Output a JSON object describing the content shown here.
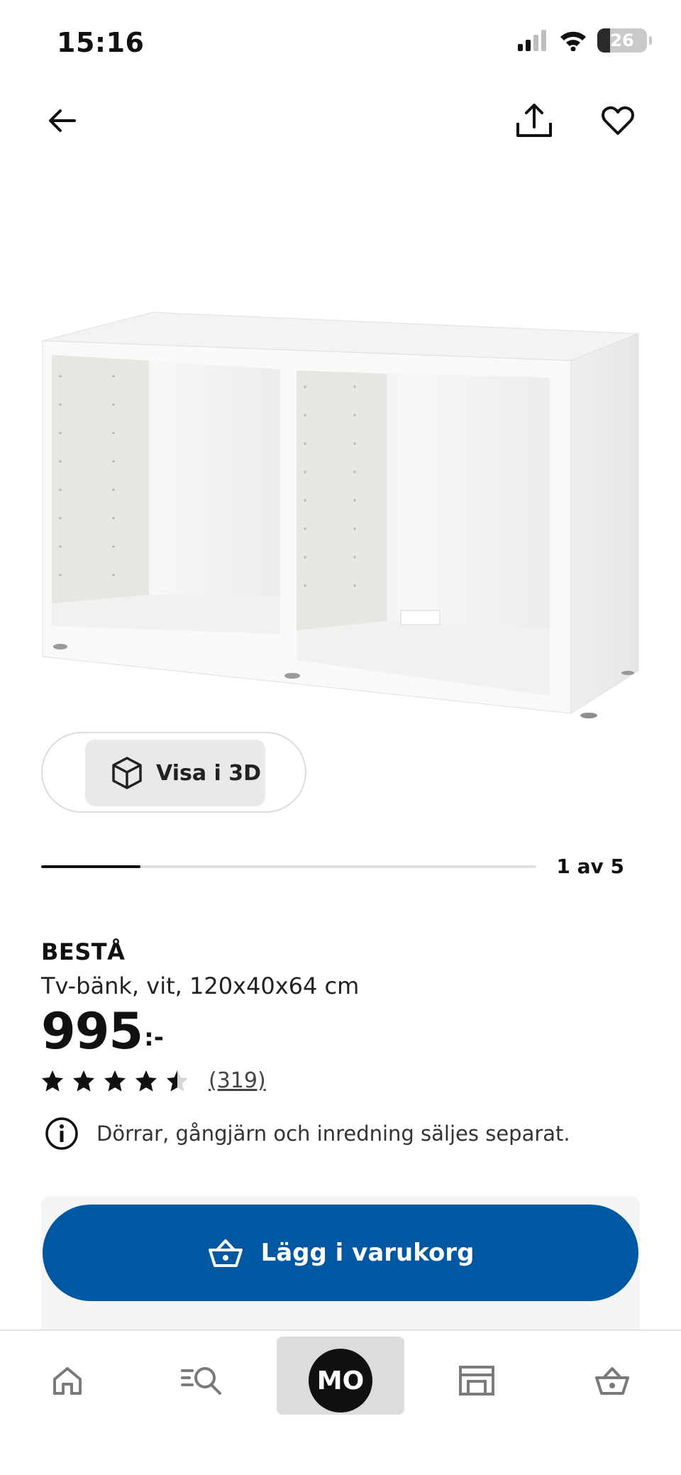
{
  "status_bar": {
    "time": "15:16",
    "battery": "26",
    "battery_level": 0.26
  },
  "topbar": {
    "back_icon": "arrow-left-icon",
    "share_icon": "share-icon",
    "favorite_icon": "heart-icon"
  },
  "gallery": {
    "view_3d_label": "Visa i 3D",
    "cube_icon": "cube-icon",
    "page_counter": "1 av 5",
    "current": 1,
    "total": 5
  },
  "product": {
    "brand": "BESTÅ",
    "description": "Tv-bänk, vit, 120x40x64 cm",
    "price": "995",
    "price_suffix": ":-",
    "rating": 4.5,
    "rating_max": 5,
    "review_count": "(319)",
    "notice": "Dörrar, gångjärn och inredning säljes separat.",
    "notice_icon": "info-icon"
  },
  "cart": {
    "label": "Lägg i varukorg",
    "icon": "basket-icon",
    "color": "#0058a3"
  },
  "bottom_nav": {
    "items": [
      {
        "name": "home",
        "icon": "home-icon"
      },
      {
        "name": "search",
        "icon": "search-icon"
      },
      {
        "name": "profile",
        "label": "MO"
      },
      {
        "name": "store",
        "icon": "store-icon"
      },
      {
        "name": "cart",
        "icon": "basket-icon"
      }
    ]
  }
}
